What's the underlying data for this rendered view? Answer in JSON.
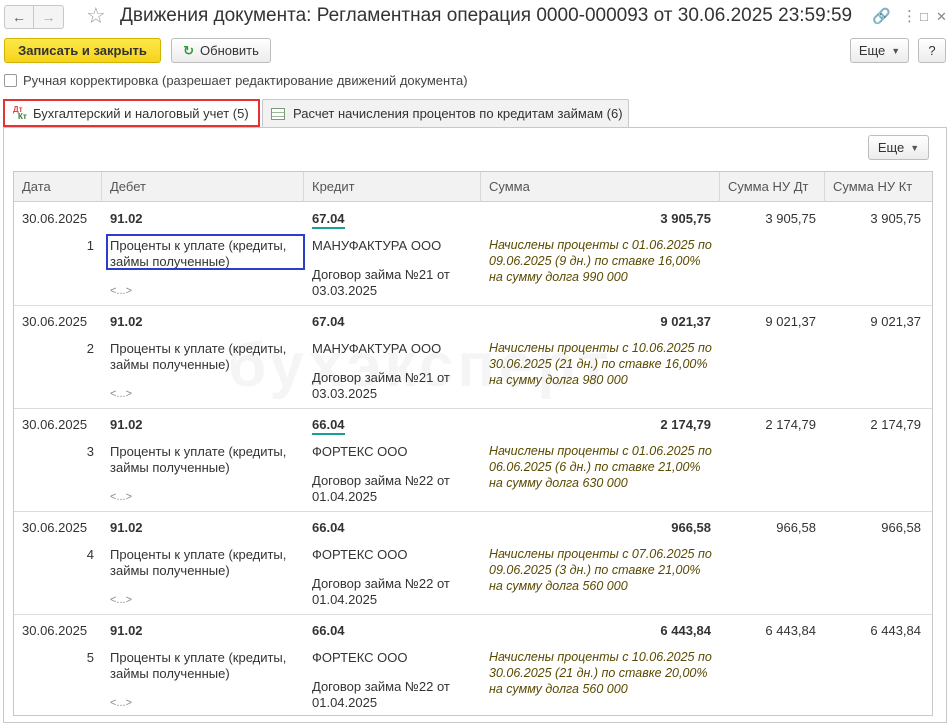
{
  "window": {
    "title": "Движения документа: Регламентная операция 0000-000093 от 30.06.2025 23:59:59",
    "back_icon": "←",
    "forward_icon": "→",
    "star_icon": "☆",
    "link_icon": "🔗",
    "more_icon": "⋮",
    "maximize_icon": "□",
    "close_icon": "✕"
  },
  "toolbar": {
    "save_close": "Записать и закрыть",
    "refresh": "Обновить",
    "refresh_icon": "↻",
    "more": "Еще",
    "help": "?"
  },
  "manual_edit": {
    "label": "Ручная корректировка (разрешает редактирование движений документа)",
    "checked": false
  },
  "tabs": [
    {
      "label": "Бухгалтерский и налоговый учет (5)",
      "icon_dt": "Дт",
      "icon_kt": "Кт",
      "active": true
    },
    {
      "label": "Расчет начисления процентов по кредитам займам (6)",
      "active": false
    }
  ],
  "grid_more": "Еще",
  "columns": [
    "Дата",
    "Дебет",
    "Кредит",
    "Сумма",
    "Сумма НУ Дт",
    "Сумма НУ Кт"
  ],
  "records": [
    {
      "date": "30.06.2025",
      "num": "1",
      "debit": "91.02",
      "debit_sub": "Проценты к уплате (кредиты, займы полученные)",
      "debit_more": "<...>",
      "credit": "67.04",
      "credit_sub1": "МАНУФАКТУРА ООО",
      "credit_sub2": "Договор займа №21 от 03.03.2025",
      "sum": "3 905,75",
      "content": "Начислены проценты с 01.06.2025 по 09.06.2025 (9 дн.) по ставке 16,00% на сумму долга 990 000",
      "nu_dt": "3 905,75",
      "nu_kt": "3 905,75"
    },
    {
      "date": "30.06.2025",
      "num": "2",
      "debit": "91.02",
      "debit_sub": "Проценты к уплате (кредиты, займы полученные)",
      "debit_more": "<...>",
      "credit": "67.04",
      "credit_sub1": "МАНУФАКТУРА ООО",
      "credit_sub2": "Договор займа №21 от 03.03.2025",
      "sum": "9 021,37",
      "content": "Начислены проценты с 10.06.2025 по 30.06.2025 (21 дн.) по ставке 16,00% на сумму долга 980 000",
      "nu_dt": "9 021,37",
      "nu_kt": "9 021,37"
    },
    {
      "date": "30.06.2025",
      "num": "3",
      "debit": "91.02",
      "debit_sub": "Проценты к уплате (кредиты, займы полученные)",
      "debit_more": "<...>",
      "credit": "66.04",
      "credit_sub1": "ФОРТЕКС ООО",
      "credit_sub2": "Договор займа №22 от 01.04.2025",
      "sum": "2 174,79",
      "content": "Начислены проценты с 01.06.2025 по 06.06.2025 (6 дн.) по ставке 21,00% на сумму долга 630 000",
      "nu_dt": "2 174,79",
      "nu_kt": "2 174,79"
    },
    {
      "date": "30.06.2025",
      "num": "4",
      "debit": "91.02",
      "debit_sub": "Проценты к уплате (кредиты, займы полученные)",
      "debit_more": "<...>",
      "credit": "66.04",
      "credit_sub1": "ФОРТЕКС ООО",
      "credit_sub2": "Договор займа №22 от 01.04.2025",
      "sum": "966,58",
      "content": "Начислены проценты с 07.06.2025 по 09.06.2025 (3 дн.) по ставке 21,00% на сумму долга 560 000",
      "nu_dt": "966,58",
      "nu_kt": "966,58"
    },
    {
      "date": "30.06.2025",
      "num": "5",
      "debit": "91.02",
      "debit_sub": "Проценты к уплате (кредиты, займы полученные)",
      "debit_more": "<...>",
      "credit": "66.04",
      "credit_sub1": "ФОРТЕКС ООО",
      "credit_sub2": "Договор займа №22 от 01.04.2025",
      "sum": "6 443,84",
      "content": "Начислены проценты с 10.06.2025 по 30.06.2025 (21 дн.) по ставке 20,00% на сумму долга 560 000",
      "nu_dt": "6 443,84",
      "nu_kt": "6 443,84"
    }
  ],
  "colors": {
    "primary_button": "#f6d31a",
    "active_tab_border": "#e63232",
    "highlight_box": "#2a3fc8",
    "credit_underline": "#17a095"
  }
}
